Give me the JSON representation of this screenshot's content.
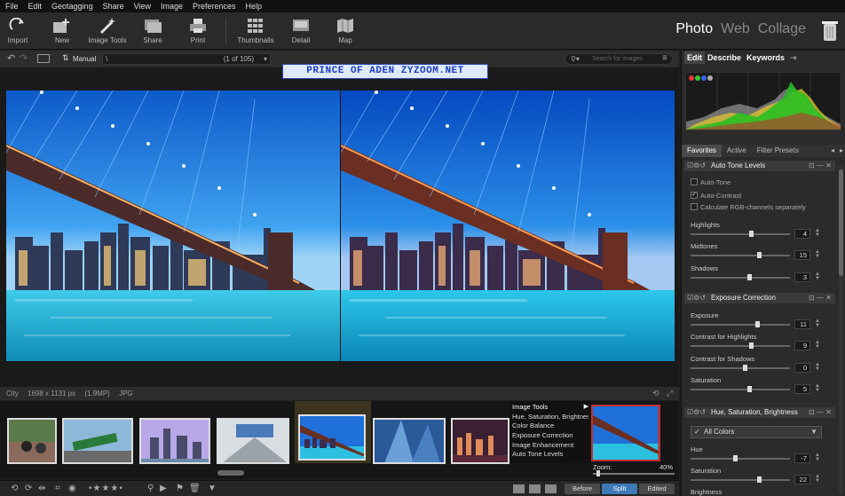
{
  "menu": [
    "File",
    "Edit",
    "Geotagging",
    "Share",
    "View",
    "Image",
    "Preferences",
    "Help"
  ],
  "toolbar": {
    "import": "Import",
    "new": "New",
    "image_tools": "Image Tools",
    "share": "Share",
    "print": "Print",
    "thumbnails": "Thumbnails",
    "detail": "Detail",
    "map": "Map"
  },
  "modes": {
    "photo": "Photo",
    "web": "Web",
    "collage": "Collage"
  },
  "subbar": {
    "sort_mode": "Manual",
    "path": "\\",
    "count": "(1 of 105)",
    "search_placeholder": "Search for images"
  },
  "watermark": "PRINCE OF ADEN ZYZOOM.NET",
  "infobar": {
    "name": "City",
    "dims": "1698 x 1131 px",
    "mp": "(1.9MP)",
    "format": "JPG"
  },
  "context_menu": {
    "header": "Image Tools",
    "items": [
      "Hue, Saturation, Brightness",
      "Color Balance",
      "Exposure Correction",
      "Image Enhancement",
      "Auto Tone Levels"
    ]
  },
  "zoom": {
    "label": "Zoom:",
    "value": "40%"
  },
  "view_buttons": {
    "before": "Before",
    "split": "Split",
    "edited": "Edited"
  },
  "right_panel": {
    "tabs": [
      "Edit",
      "Describe",
      "Keywords"
    ],
    "panel_tabs": [
      "Favorites",
      "Active",
      "Filter Presets"
    ],
    "auto_tone": {
      "title": "Auto Tone Levels",
      "checks": [
        {
          "label": "Auto-Tone",
          "checked": false
        },
        {
          "label": "Auto-Contrast",
          "checked": true
        },
        {
          "label": "Calculate RGB-channels separately",
          "checked": false
        }
      ],
      "sliders": [
        {
          "label": "Highlights",
          "value": "4",
          "pos": 0.62
        },
        {
          "label": "Midtones",
          "value": "15",
          "pos": 0.7
        },
        {
          "label": "Shadows",
          "value": "3",
          "pos": 0.6
        }
      ]
    },
    "exposure": {
      "title": "Exposure Correction",
      "sliders": [
        {
          "label": "Exposure",
          "value": "11",
          "pos": 0.68
        },
        {
          "label": "Contrast for Highlights",
          "value": "9",
          "pos": 0.62
        },
        {
          "label": "Contrast for Shadows",
          "value": "0",
          "pos": 0.55
        },
        {
          "label": "Saturation",
          "value": "5",
          "pos": 0.6
        }
      ]
    },
    "hsb": {
      "title": "Hue, Saturation, Brightness",
      "combo": "All Colors",
      "sliders": [
        {
          "label": "Hue",
          "value": "-7",
          "pos": 0.45
        },
        {
          "label": "Saturation",
          "value": "22",
          "pos": 0.7
        },
        {
          "label": "Brightness",
          "value": "",
          "pos": 0.5
        }
      ]
    }
  },
  "colors": {
    "accent": "#3e79b8",
    "bg": "#1e1e1e",
    "panel": "#2b2b2b"
  }
}
